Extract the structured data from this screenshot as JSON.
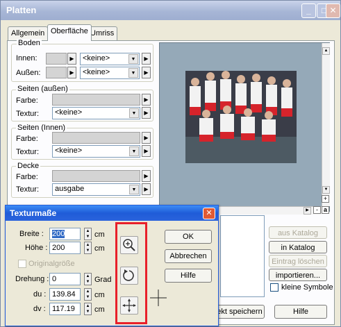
{
  "window": {
    "title": "Platten"
  },
  "tabs": [
    "Allgemein",
    "Oberfläche",
    "Umriss"
  ],
  "groups": {
    "boden": {
      "title": "Boden",
      "innen_label": "Innen:",
      "aussen_label": "Außen:",
      "innen_value": "<keine>",
      "aussen_value": "<keine>"
    },
    "seiten_aussen": {
      "title": "Seiten (außen)",
      "farbe_label": "Farbe:",
      "textur_label": "Textur:",
      "textur_value": "<keine>"
    },
    "seiten_innen": {
      "title": "Seiten (Innen)",
      "farbe_label": "Farbe:",
      "textur_label": "Textur:",
      "textur_value": "<keine>"
    },
    "decke": {
      "title": "Decke",
      "farbe_label": "Farbe:",
      "textur_label": "Textur:",
      "textur_value": "ausgabe"
    }
  },
  "preview": {
    "zoom_in": "+",
    "zoom_out": "-",
    "zoom_a": "a"
  },
  "right_buttons": {
    "aus_katalog": "aus Katalog",
    "in_katalog": "in Katalog",
    "eintrag_loeschen": "Eintrag löschen",
    "importieren": "importieren...",
    "kleine_symbole": "kleine Symbole"
  },
  "bottom_buttons": {
    "speichern": "ekt speichern",
    "hilfe": "Hilfe"
  },
  "dialog": {
    "title": "Texturmaße",
    "breite_label": "Breite :",
    "breite_value": "200",
    "hoehe_label": "Höhe :",
    "hoehe_value": "200",
    "unit_cm": "cm",
    "originalgroesse": "Originalgröße",
    "drehung_label": "Drehung :",
    "drehung_value": "0",
    "unit_grad": "Grad",
    "du_label": "du :",
    "du_value": "139.84",
    "dv_label": "dv :",
    "dv_value": "117.19",
    "ok": "OK",
    "abbrechen": "Abbrechen",
    "hilfe": "Hilfe"
  },
  "colors": {
    "highlight_frame": "#e8202a",
    "dialog_titlebar": "#2a63dc"
  }
}
